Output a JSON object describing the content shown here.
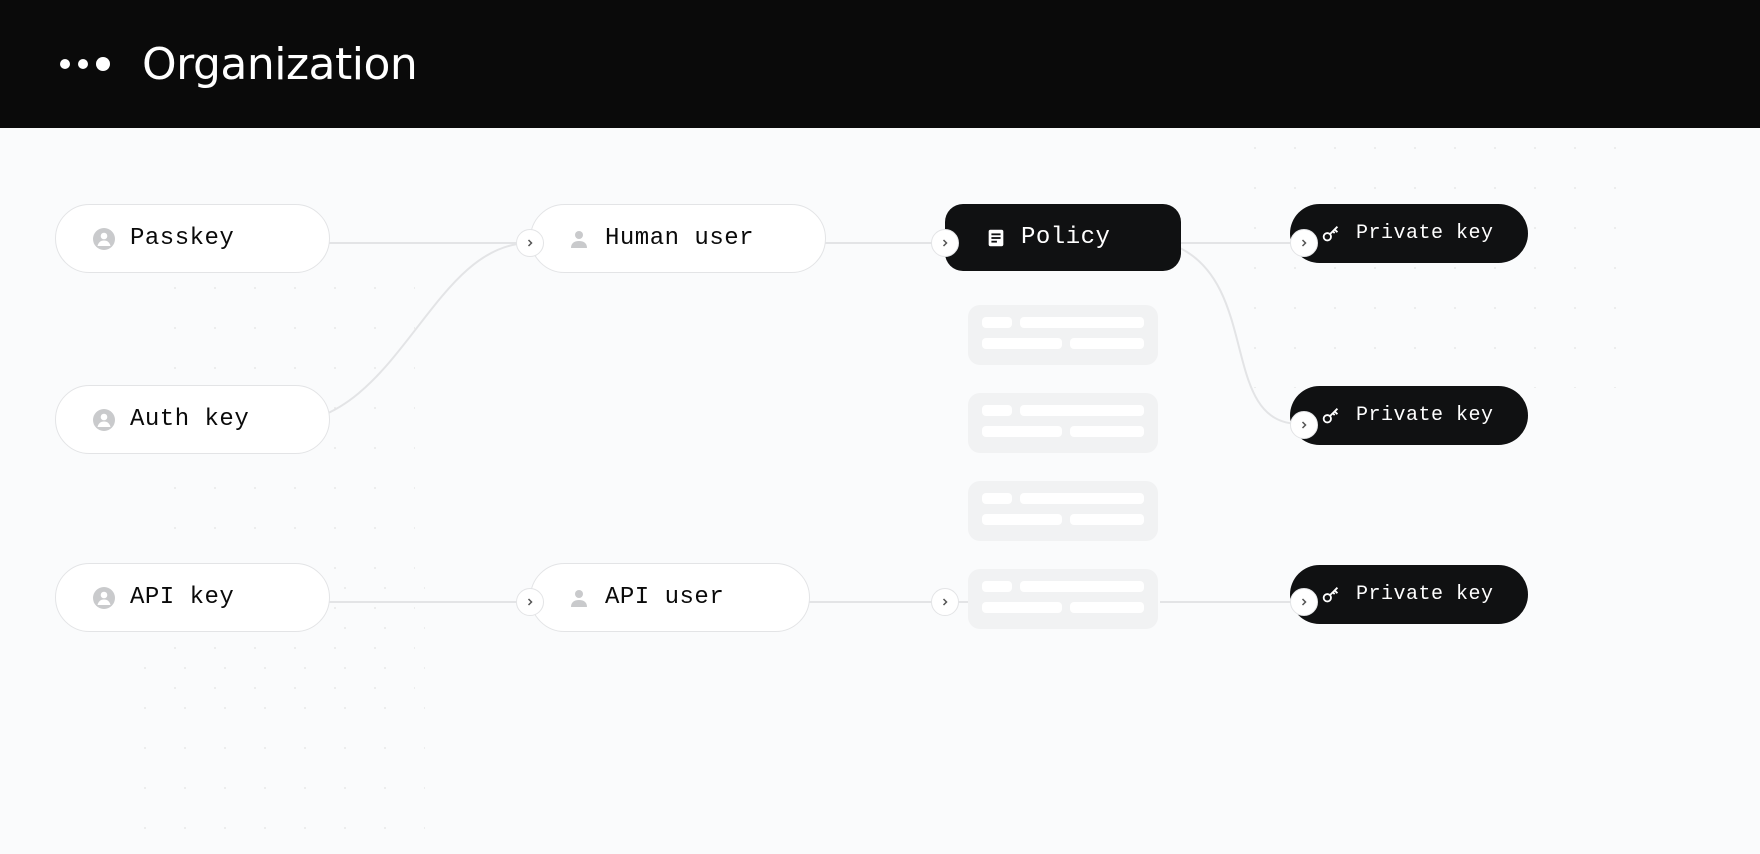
{
  "header": {
    "title": "Organization"
  },
  "nodes": {
    "passkey": {
      "label": "Passkey"
    },
    "authkey": {
      "label": "Auth key"
    },
    "apikey": {
      "label": "API key"
    },
    "humanuser": {
      "label": "Human user"
    },
    "apiuser": {
      "label": "API user"
    },
    "policy": {
      "label": "Policy"
    },
    "privatekey1": {
      "label": "Private key"
    },
    "privatekey2": {
      "label": "Private key"
    },
    "privatekey3": {
      "label": "Private key"
    }
  }
}
